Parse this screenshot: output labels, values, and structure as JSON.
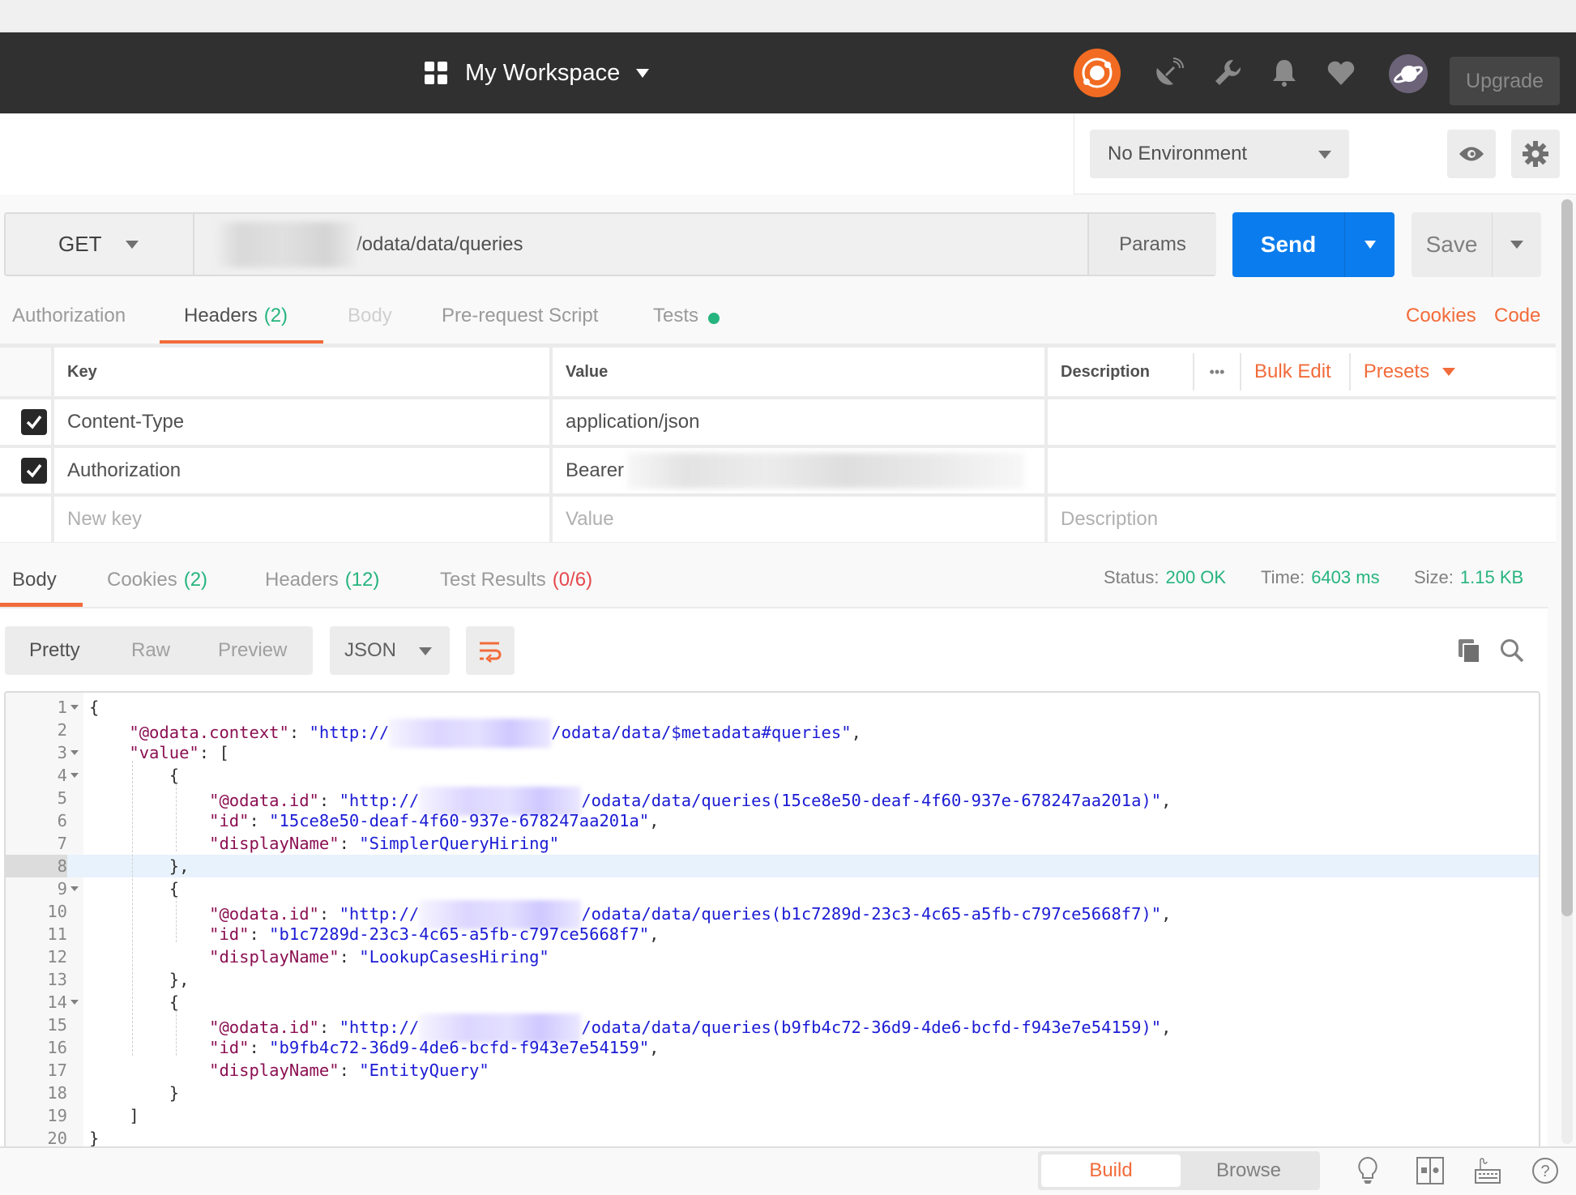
{
  "header": {
    "workspace_label": "My Workspace",
    "upgrade_label": "Upgrade",
    "icons": [
      "sync-icon",
      "satellite-icon",
      "wrench-icon",
      "bell-icon",
      "heart-icon",
      "avatar-planet-icon"
    ]
  },
  "environment": {
    "selected": "No Environment"
  },
  "request": {
    "method": "GET",
    "url_path": "/odata/data/queries",
    "params_label": "Params",
    "send_label": "Send",
    "save_label": "Save"
  },
  "request_tabs": [
    {
      "label": "Authorization",
      "state": "normal"
    },
    {
      "label": "Headers",
      "count": "(2)",
      "state": "active"
    },
    {
      "label": "Body",
      "state": "disabled"
    },
    {
      "label": "Pre-request Script",
      "state": "normal"
    },
    {
      "label": "Tests",
      "state": "normal",
      "indicator": "green-dot"
    }
  ],
  "request_links": {
    "cookies": "Cookies",
    "code": "Code"
  },
  "headers_table": {
    "columns": [
      "Key",
      "Value",
      "Description"
    ],
    "more_label": "•••",
    "bulk_edit": "Bulk Edit",
    "presets": "Presets",
    "rows": [
      {
        "checked": true,
        "key": "Content-Type",
        "value": "application/json",
        "description": ""
      },
      {
        "checked": true,
        "key": "Authorization",
        "value": "Bearer",
        "description": ""
      }
    ],
    "placeholders": {
      "key": "New key",
      "value": "Value",
      "description": "Description"
    }
  },
  "response_tabs": [
    {
      "label": "Body",
      "state": "active"
    },
    {
      "label": "Cookies",
      "count": "(2)",
      "count_color": "green"
    },
    {
      "label": "Headers",
      "count": "(12)",
      "count_color": "green"
    },
    {
      "label": "Test Results",
      "count": "(0/6)",
      "count_color": "red"
    }
  ],
  "response_meta": {
    "status_label": "Status:",
    "status_value": "200 OK",
    "time_label": "Time:",
    "time_value": "6403 ms",
    "size_label": "Size:",
    "size_value": "1.15 KB"
  },
  "body_view": {
    "modes": [
      "Pretty",
      "Raw",
      "Preview"
    ],
    "active_mode": "Pretty",
    "format": "JSON"
  },
  "code_lines": [
    {
      "n": "1",
      "fold": true,
      "parts": [
        [
          "p",
          "{"
        ]
      ]
    },
    {
      "n": "2",
      "parts": [
        [
          "i1",
          ""
        ],
        [
          "k",
          "\"@odata.context\""
        ],
        [
          "p",
          ": "
        ],
        [
          "s",
          "\"http://"
        ],
        [
          "blur",
          ""
        ],
        [
          "s",
          "/odata/data/$metadata#queries\""
        ],
        [
          "p",
          ","
        ]
      ]
    },
    {
      "n": "3",
      "fold": true,
      "parts": [
        [
          "i1",
          ""
        ],
        [
          "k",
          "\"value\""
        ],
        [
          "p",
          ": ["
        ]
      ]
    },
    {
      "n": "4",
      "fold": true,
      "parts": [
        [
          "i2",
          ""
        ],
        [
          "p",
          "{"
        ]
      ]
    },
    {
      "n": "5",
      "parts": [
        [
          "i3",
          ""
        ],
        [
          "k",
          "\"@odata.id\""
        ],
        [
          "p",
          ": "
        ],
        [
          "s",
          "\"http://"
        ],
        [
          "blur",
          ""
        ],
        [
          "s",
          "/odata/data/queries(15ce8e50-deaf-4f60-937e-678247aa201a)\""
        ],
        [
          "p",
          ","
        ]
      ]
    },
    {
      "n": "6",
      "parts": [
        [
          "i3",
          ""
        ],
        [
          "k",
          "\"id\""
        ],
        [
          "p",
          ": "
        ],
        [
          "s",
          "\"15ce8e50-deaf-4f60-937e-678247aa201a\""
        ],
        [
          "p",
          ","
        ]
      ]
    },
    {
      "n": "7",
      "parts": [
        [
          "i3",
          ""
        ],
        [
          "k",
          "\"displayName\""
        ],
        [
          "p",
          ": "
        ],
        [
          "s",
          "\"SimplerQueryHiring\""
        ]
      ]
    },
    {
      "n": "8",
      "highlight": true,
      "parts": [
        [
          "i2",
          ""
        ],
        [
          "p",
          "},"
        ]
      ]
    },
    {
      "n": "9",
      "fold": true,
      "parts": [
        [
          "i2",
          ""
        ],
        [
          "p",
          "{"
        ]
      ]
    },
    {
      "n": "10",
      "parts": [
        [
          "i3",
          ""
        ],
        [
          "k",
          "\"@odata.id\""
        ],
        [
          "p",
          ": "
        ],
        [
          "s",
          "\"http://"
        ],
        [
          "blur",
          ""
        ],
        [
          "s",
          "/odata/data/queries(b1c7289d-23c3-4c65-a5fb-c797ce5668f7)\""
        ],
        [
          "p",
          ","
        ]
      ]
    },
    {
      "n": "11",
      "parts": [
        [
          "i3",
          ""
        ],
        [
          "k",
          "\"id\""
        ],
        [
          "p",
          ": "
        ],
        [
          "s",
          "\"b1c7289d-23c3-4c65-a5fb-c797ce5668f7\""
        ],
        [
          "p",
          ","
        ]
      ]
    },
    {
      "n": "12",
      "parts": [
        [
          "i3",
          ""
        ],
        [
          "k",
          "\"displayName\""
        ],
        [
          "p",
          ": "
        ],
        [
          "s",
          "\"LookupCasesHiring\""
        ]
      ]
    },
    {
      "n": "13",
      "parts": [
        [
          "i2",
          ""
        ],
        [
          "p",
          "},"
        ]
      ]
    },
    {
      "n": "14",
      "fold": true,
      "parts": [
        [
          "i2",
          ""
        ],
        [
          "p",
          "{"
        ]
      ]
    },
    {
      "n": "15",
      "parts": [
        [
          "i3",
          ""
        ],
        [
          "k",
          "\"@odata.id\""
        ],
        [
          "p",
          ": "
        ],
        [
          "s",
          "\"http://"
        ],
        [
          "blur",
          ""
        ],
        [
          "s",
          "/odata/data/queries(b9fb4c72-36d9-4de6-bcfd-f943e7e54159)\""
        ],
        [
          "p",
          ","
        ]
      ]
    },
    {
      "n": "16",
      "parts": [
        [
          "i3",
          ""
        ],
        [
          "k",
          "\"id\""
        ],
        [
          "p",
          ": "
        ],
        [
          "s",
          "\"b9fb4c72-36d9-4de6-bcfd-f943e7e54159\""
        ],
        [
          "p",
          ","
        ]
      ]
    },
    {
      "n": "17",
      "parts": [
        [
          "i3",
          ""
        ],
        [
          "k",
          "\"displayName\""
        ],
        [
          "p",
          ": "
        ],
        [
          "s",
          "\"EntityQuery\""
        ]
      ]
    },
    {
      "n": "18",
      "parts": [
        [
          "i2",
          ""
        ],
        [
          "p",
          "}"
        ]
      ]
    },
    {
      "n": "19",
      "parts": [
        [
          "i1",
          ""
        ],
        [
          "p",
          "]"
        ]
      ]
    },
    {
      "n": "20",
      "parts": [
        [
          "p",
          "}"
        ]
      ]
    }
  ],
  "footer": {
    "build_label": "Build",
    "browse_label": "Browse",
    "icons": [
      "lightbulb-icon",
      "two-pane-icon",
      "keyboard-icon",
      "help-icon"
    ]
  },
  "colors": {
    "accent_orange": "#f26b3a",
    "send_blue": "#0b7ced",
    "success_green": "#26b47f",
    "error_red": "#e5484d",
    "header_dark": "#303030"
  }
}
